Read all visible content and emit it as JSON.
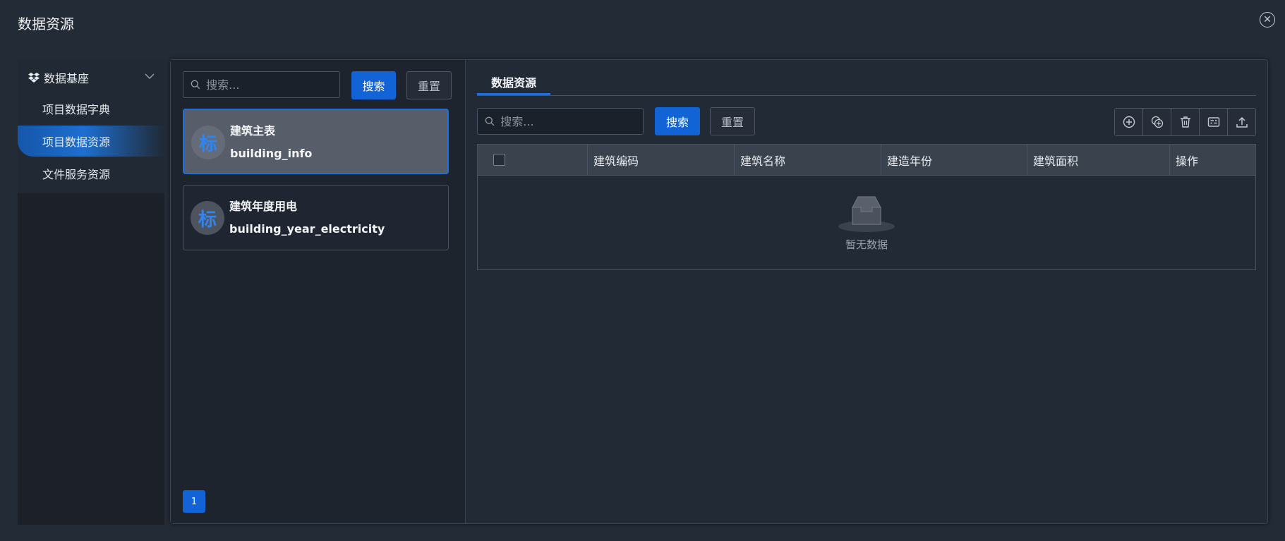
{
  "dialog": {
    "title": "数据资源"
  },
  "nav": {
    "group_label": "数据基座",
    "items": [
      {
        "label": "项目数据字典",
        "active": false
      },
      {
        "label": "项目数据资源",
        "active": true
      },
      {
        "label": "文件服务资源",
        "active": false
      }
    ]
  },
  "list_pane": {
    "search_placeholder": "搜索...",
    "search_button": "搜索",
    "reset_button": "重置",
    "cards": [
      {
        "avatar": "标",
        "title": "建筑主表",
        "subtitle": "building_info",
        "selected": true
      },
      {
        "avatar": "标",
        "title": "建筑年度用电",
        "subtitle": "building_year_electricity",
        "selected": false
      }
    ],
    "page": "1"
  },
  "detail": {
    "tab": "数据资源",
    "search_placeholder": "搜索...",
    "search_button": "搜索",
    "reset_button": "重置",
    "toolbar_icons": [
      "add-circle-icon",
      "batch-add-icon",
      "trash-icon",
      "form-icon",
      "upload-icon"
    ],
    "columns": [
      "建筑编码",
      "建筑名称",
      "建造年份",
      "建筑面积",
      "操作"
    ],
    "empty_text": "暂无数据"
  },
  "colors": {
    "accent": "#1264d6",
    "background": "#232b36",
    "panel": "#1d242e"
  }
}
